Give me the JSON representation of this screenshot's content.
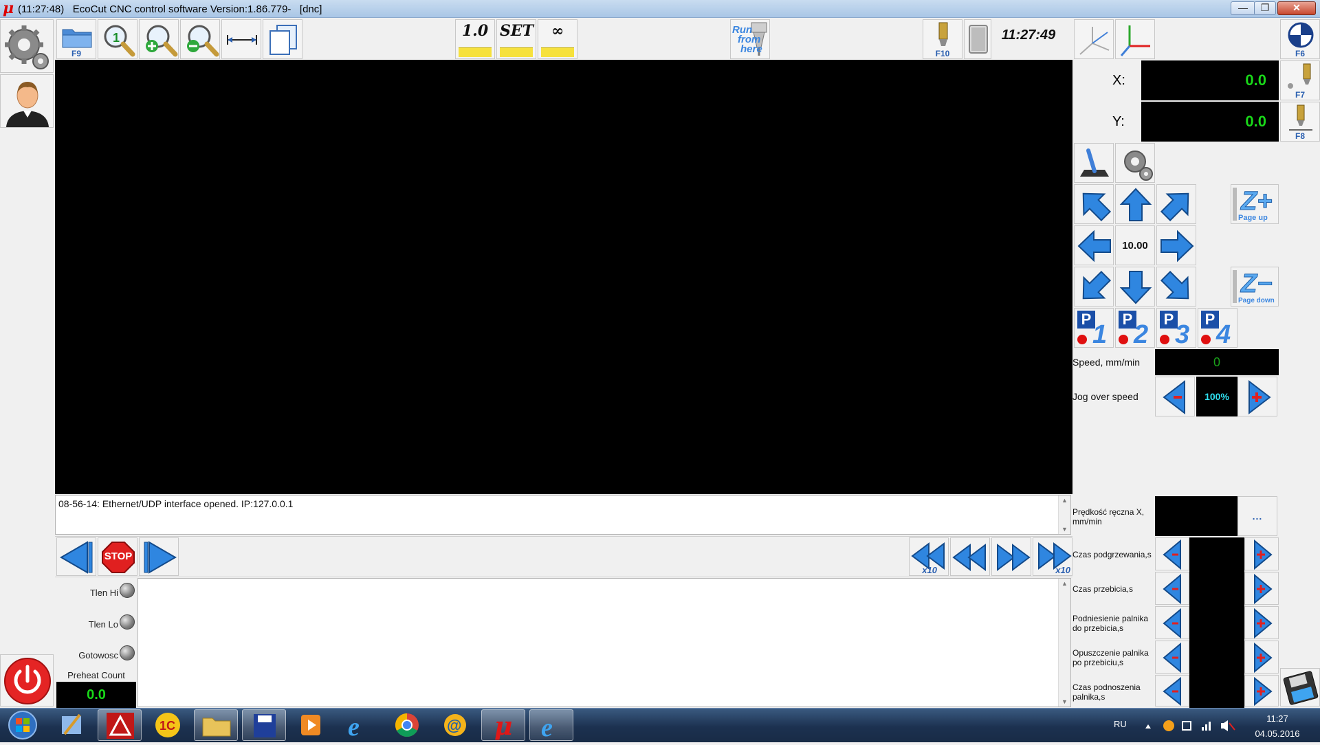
{
  "window": {
    "logo": "μ",
    "title": "(11:27:48)   EcoCut CNC control software Version:1.86.779-   [dnc]",
    "minimize": "—",
    "maximize": "❐",
    "close": "✕"
  },
  "toolbar": {
    "open_key": "F9",
    "scale_1": "1.0",
    "scale_set": "SET",
    "scale_inf": "∞",
    "run_from_here": [
      "Run",
      "from",
      "here"
    ],
    "torch_key": "F10",
    "clock": "11:27:49"
  },
  "right_top": {
    "f6": "F6",
    "f7": "F7",
    "f8": "F8"
  },
  "dro": {
    "x_label": "X:",
    "x_value": "0.0",
    "y_label": "Y:",
    "y_value": "0.0"
  },
  "jog": {
    "step": "10.00",
    "z_plus_sub": "Page up",
    "z_minus_sub": "Page down",
    "presets": [
      "1",
      "2",
      "3",
      "4"
    ],
    "speed_label": "Speed, mm/min",
    "speed_value": "0",
    "override_label": "Jog over speed",
    "override_value": "100%"
  },
  "console": {
    "message": "08-56-14: Ethernet/UDP interface opened. IP:127.0.0.1"
  },
  "transport": {
    "stop_label": "STOP",
    "x10_left": "x10",
    "x10_right": "x10"
  },
  "indicators": {
    "tlen_hi": "Tlen Hi",
    "tlen_lo": "Tlen Lo",
    "gotowosc": "Gotowosc",
    "preheat_label": "Preheat Count",
    "preheat_value": "0.0"
  },
  "params": {
    "manual_speed": [
      "Prędkość ręczna X,",
      "mm/min"
    ],
    "manual_speed_more": "...",
    "items": [
      {
        "label": [
          "Czas podgrzewania,s"
        ]
      },
      {
        "label": [
          "Czas przebicia,s"
        ]
      },
      {
        "label": [
          "Podniesienie palnika",
          "do przebicia,s"
        ]
      },
      {
        "label": [
          "Opuszczenie palnika",
          "po przebiciu,s"
        ]
      },
      {
        "label": [
          "Czas podnoszenia",
          "palnika,s"
        ]
      }
    ]
  },
  "taskbar": {
    "lang": "RU",
    "time": "11:27",
    "date": "04.05.2016"
  },
  "colors": {
    "accent_blue": "#2f86e0",
    "dro_green": "#19d919",
    "override_cyan": "#2fe0f0",
    "stop_red": "#e02020"
  }
}
